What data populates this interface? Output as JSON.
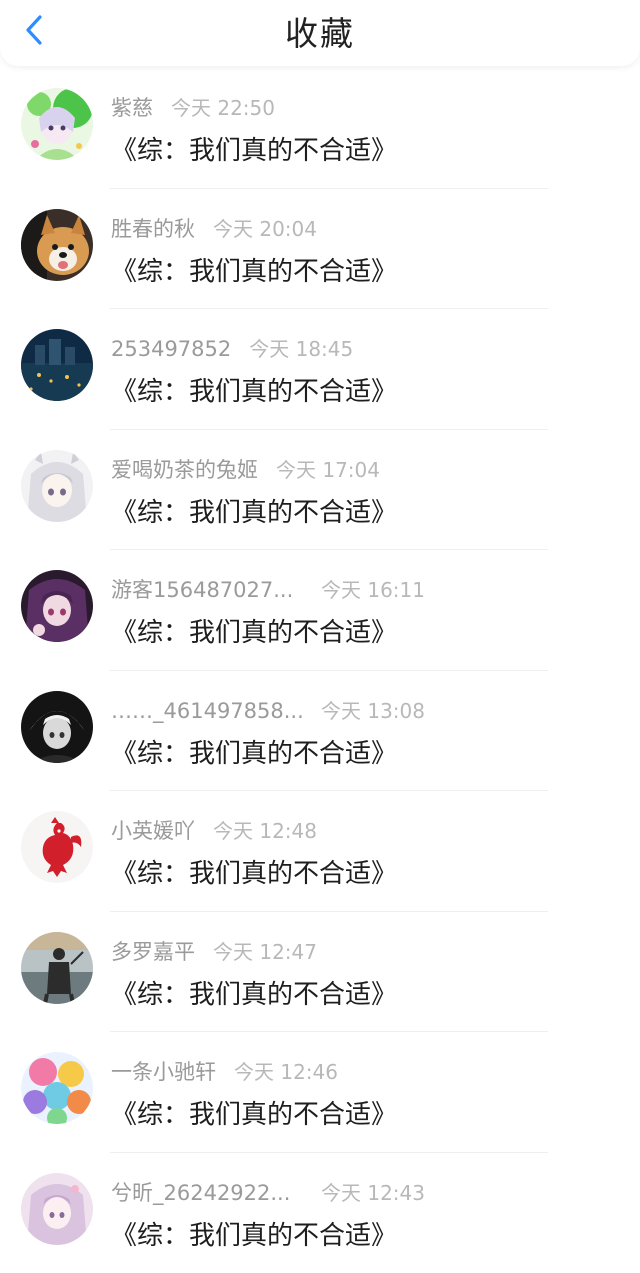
{
  "header": {
    "title": "收藏",
    "back_icon": "chevron-left-icon",
    "accent_color": "#2f8cff"
  },
  "items": [
    {
      "user": "紫慈",
      "time": "今天 22:50",
      "book": "《综：我们真的不合适》",
      "avatar": "anime-avatar-green"
    },
    {
      "user": "胜春的秋",
      "time": "今天 20:04",
      "book": "《综：我们真的不合适》",
      "avatar": "dog-avatar"
    },
    {
      "user": "253497852",
      "time": "今天 18:45",
      "book": "《综：我们真的不合适》",
      "avatar": "night-scene-avatar"
    },
    {
      "user": "爱喝奶茶的兔姬",
      "time": "今天 17:04",
      "book": "《综：我们真的不合适》",
      "avatar": "anime-avatar-white-hair"
    },
    {
      "user": "游客156487027...",
      "time": "今天 16:11",
      "book": "《综：我们真的不合适》",
      "avatar": "anime-avatar-purple"
    },
    {
      "user": "……_461497858...",
      "time": "今天 13:08",
      "book": "《综：我们真的不合适》",
      "avatar": "anime-avatar-dark"
    },
    {
      "user": "小英媛吖",
      "time": "今天 12:48",
      "book": "《综：我们真的不合适》",
      "avatar": "red-rooster-avatar"
    },
    {
      "user": "多罗嘉平",
      "time": "今天 12:47",
      "book": "《综：我们真的不合适》",
      "avatar": "samurai-avatar"
    },
    {
      "user": "一条小驰轩",
      "time": "今天 12:46",
      "book": "《综：我们真的不合适》",
      "avatar": "balloons-avatar"
    },
    {
      "user": "兮昕_26242922...",
      "time": "今天 12:43",
      "book": "《综：我们真的不合适》",
      "avatar": "anime-avatar-pink"
    }
  ]
}
